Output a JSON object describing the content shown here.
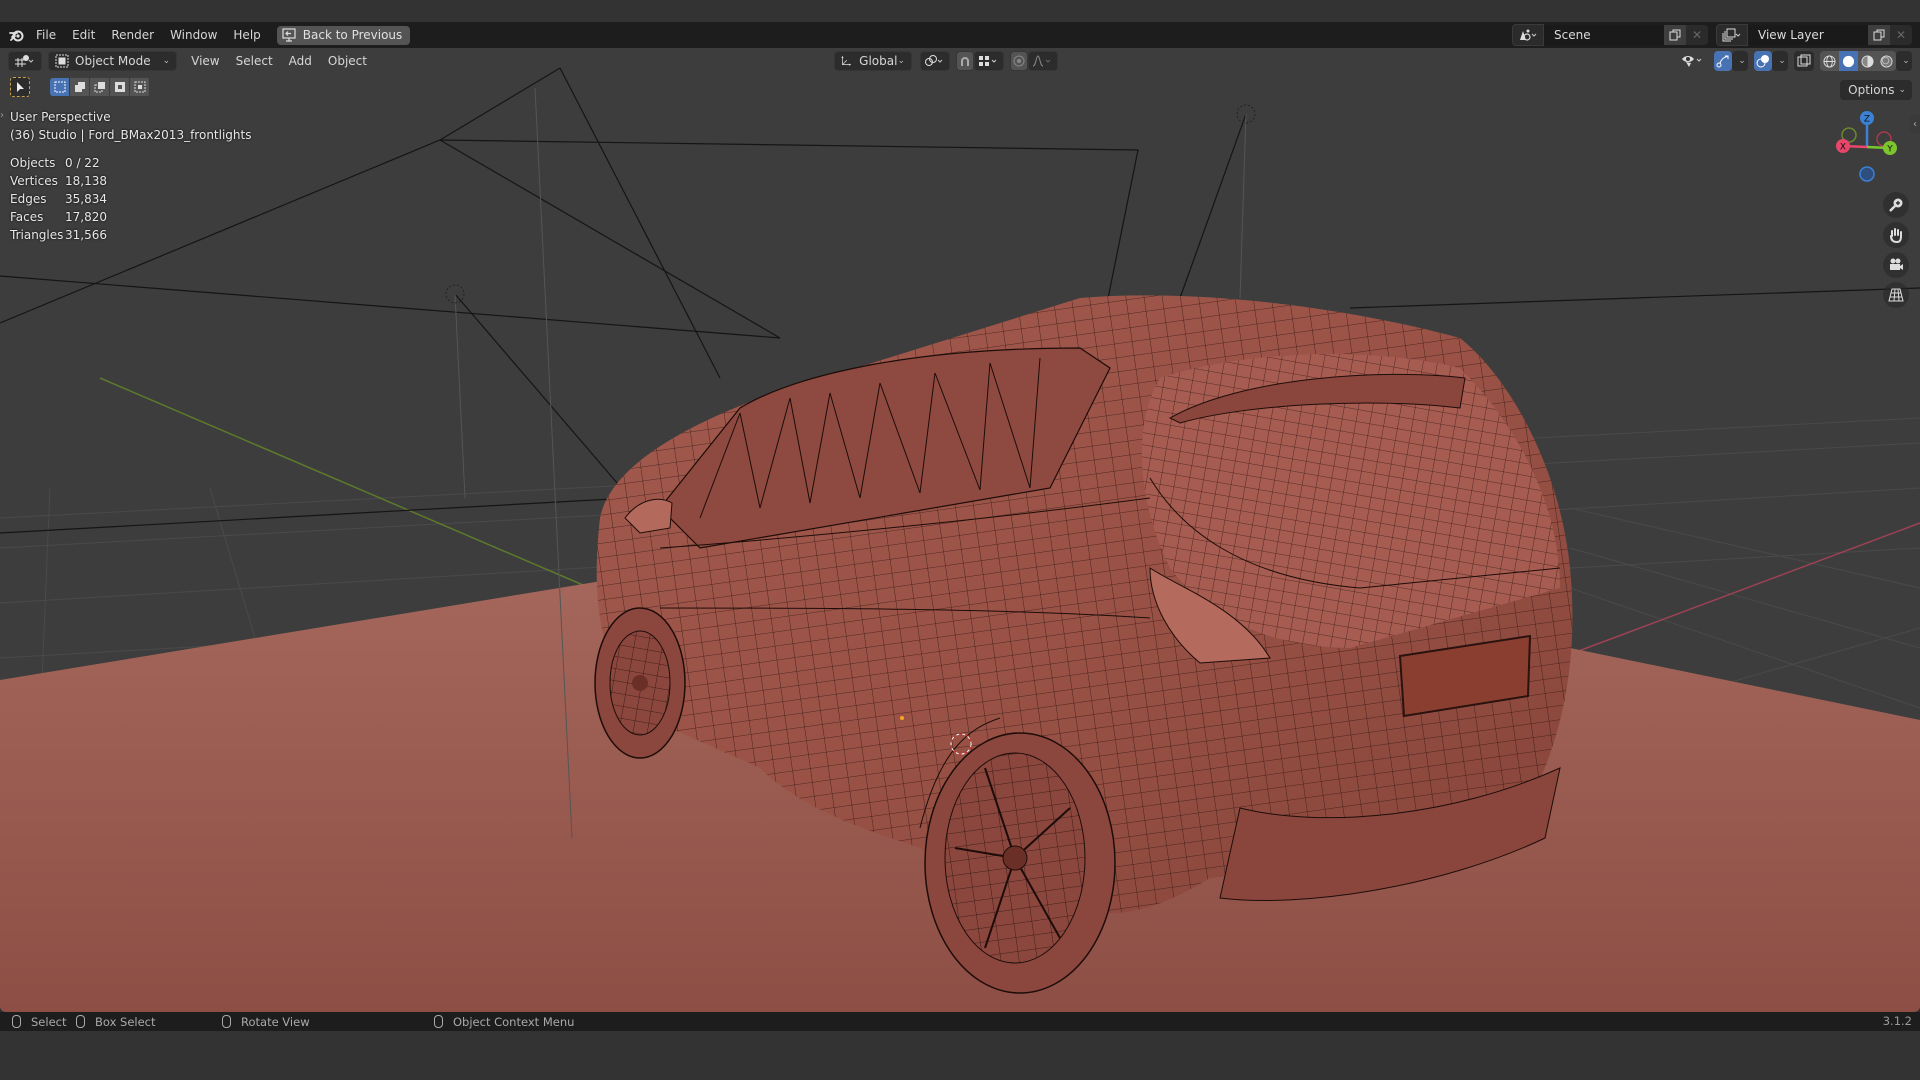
{
  "app": {
    "name": "Blender",
    "version": "3.1.2"
  },
  "menubar": {
    "items": [
      "File",
      "Edit",
      "Render",
      "Window",
      "Help"
    ],
    "back_button": "Back to Previous",
    "scene": {
      "label": "Scene",
      "icon": "scene-icon"
    },
    "view_layer": {
      "label": "View Layer",
      "icon": "render-layers-icon"
    }
  },
  "viewport_header": {
    "editor_type_icon": "3d-viewport-icon",
    "mode": "Object Mode",
    "menus": [
      "View",
      "Select",
      "Add",
      "Object"
    ],
    "transform_orientation": "Global",
    "pivot_icon": "pivot-point-icon",
    "snap_icon": "magnet-icon",
    "snap_target_icon": "snap-increment-icon",
    "proportional_icon": "proportional-edit-icon",
    "falloff_icon": "falloff-smooth-icon",
    "right_icons": [
      "selectability-visibility-icon",
      "gizmo-icon",
      "overlay-icon",
      "xray-icon",
      "wireframe-shading-icon",
      "solid-shading-icon",
      "material-shading-icon",
      "rendered-shading-icon"
    ],
    "active_shading": "solid",
    "options_label": "Options"
  },
  "toolbar": {
    "active_tool": "select-box",
    "select_modes": [
      "set-new",
      "extend",
      "subtract",
      "invert",
      "intersect"
    ],
    "active_select_mode": "set-new"
  },
  "overlay": {
    "view_name": "User Perspective",
    "context": "(36) Studio | Ford_BMax2013_frontlights",
    "stats": [
      {
        "label": "Objects",
        "value": "0 / 22"
      },
      {
        "label": "Vertices",
        "value": "18,138"
      },
      {
        "label": "Edges",
        "value": "35,834"
      },
      {
        "label": "Faces",
        "value": "17,820"
      },
      {
        "label": "Triangles",
        "value": "31,566"
      }
    ]
  },
  "navigation_gizmo": {
    "axes": [
      "X",
      "Y",
      "Z"
    ],
    "buttons": [
      "zoom-icon",
      "pan-hand-icon",
      "camera-icon",
      "ortho-grid-icon"
    ]
  },
  "scene_colors": {
    "background": "#3d3d3d",
    "floor": "#a0645a",
    "mesh": "#9a5348",
    "wire": "#1a0d0a",
    "x_axis": "#e8466a",
    "y_axis": "#7dc52e",
    "z_axis": "#3b82d6"
  },
  "statusbar": {
    "items": [
      {
        "icon": "mouse-left-icon",
        "label": "Select"
      },
      {
        "icon": "mouse-left-drag-icon",
        "label": "Box Select"
      },
      {
        "icon": "mouse-middle-icon",
        "label": "Rotate View"
      },
      {
        "icon": "mouse-right-icon",
        "label": "Object Context Menu"
      }
    ],
    "version": "3.1.2"
  }
}
